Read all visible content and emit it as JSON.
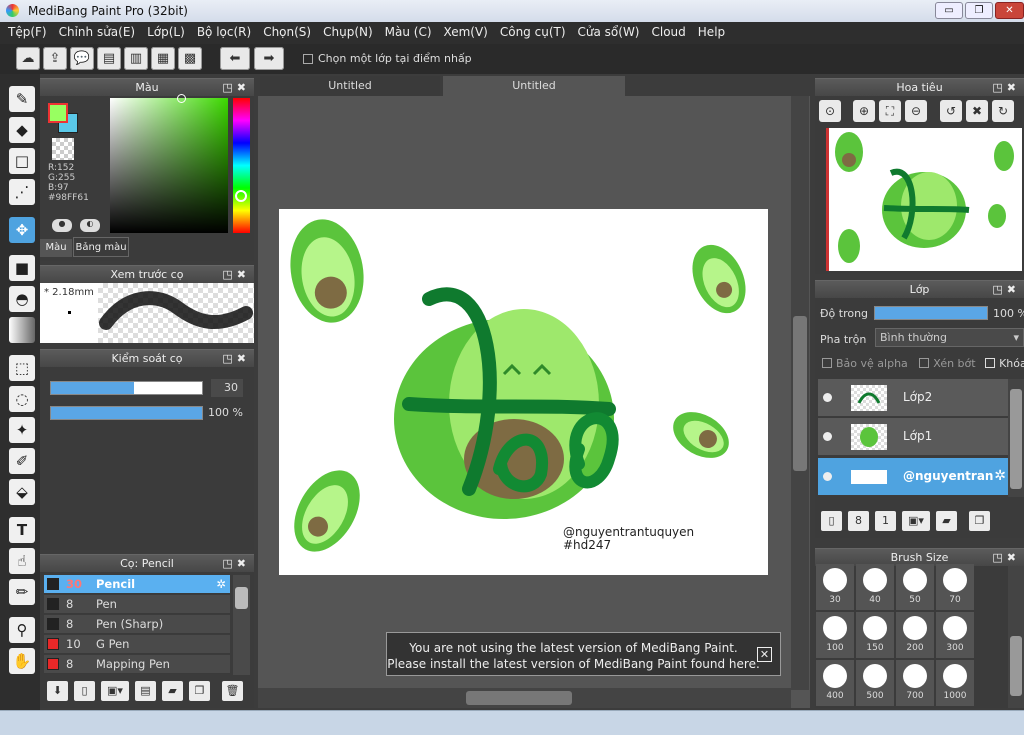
{
  "window": {
    "title": "MediBang Paint Pro (32bit)",
    "controls": [
      "▭",
      "❐",
      "✕"
    ]
  },
  "menu": [
    "Tệp(F)",
    "Chỉnh sửa(E)",
    "Lớp(L)",
    "Bộ lọc(R)",
    "Chọn(S)",
    "Chụp(N)",
    "Màu (C)",
    "Xem(V)",
    "Công cụ(T)",
    "Cửa sổ(W)",
    "Cloud",
    "Help"
  ],
  "toolbar": {
    "select_one_layer_label": "Chọn một lớp tại điểm nhấp"
  },
  "color_panel": {
    "title": "Màu",
    "r": "R:152",
    "g": "G:255",
    "b": "B:97",
    "hex": "#98FF61",
    "tab_color": "Màu",
    "tab_palette": "Bảng màu",
    "fg_color": "#98ff61",
    "bg_color": "#ff2020"
  },
  "brush_preview": {
    "title": "Xem trước cọ",
    "size": "* 2.18mm"
  },
  "brush_control": {
    "title": "Kiểm soát cọ",
    "size_value": "30",
    "opacity_value": "100 %",
    "size_fraction": 0.55,
    "opacity_fraction": 1.0
  },
  "brush_panel": {
    "title": "Cọ: Pencil",
    "items": [
      {
        "size": "30",
        "name": "Pencil",
        "color": "#222222",
        "selected": true
      },
      {
        "size": "8",
        "name": "Pen",
        "color": "#222222"
      },
      {
        "size": "8",
        "name": "Pen (Sharp)",
        "color": "#222222"
      },
      {
        "size": "10",
        "name": "G Pen",
        "color": "#e82828"
      },
      {
        "size": "8",
        "name": "Mapping Pen",
        "color": "#e82828"
      }
    ]
  },
  "tabs": [
    "Untitled",
    "Untitled"
  ],
  "artwork": {
    "title_word": "bơ",
    "credit": "@nguyentrantuquyen",
    "hashtag": "#hd247"
  },
  "notification": {
    "line1": "You are not using the latest version of MediBang Paint.",
    "line2": "Please install the latest version of MediBang Paint found here."
  },
  "navigator": {
    "title": "Hoa tiêu"
  },
  "layer_panel": {
    "title": "Lớp",
    "opacity_label": "Độ trong",
    "opacity_value": "100 %",
    "blend_label": "Pha trộn",
    "blend_value": "Bình thường",
    "protect_alpha": "Bảo vệ alpha",
    "clipping": "Xén bớt",
    "lock": "Khóa",
    "layers": [
      {
        "name": "Lớp2",
        "selected": false
      },
      {
        "name": "Lớp1",
        "selected": false
      },
      {
        "name": "@nguyentran",
        "selected": true
      }
    ]
  },
  "brush_size": {
    "title": "Brush Size",
    "sizes": [
      "30",
      "40",
      "50",
      "70",
      "100",
      "150",
      "200",
      "300",
      "400",
      "500",
      "700",
      "1000"
    ]
  }
}
